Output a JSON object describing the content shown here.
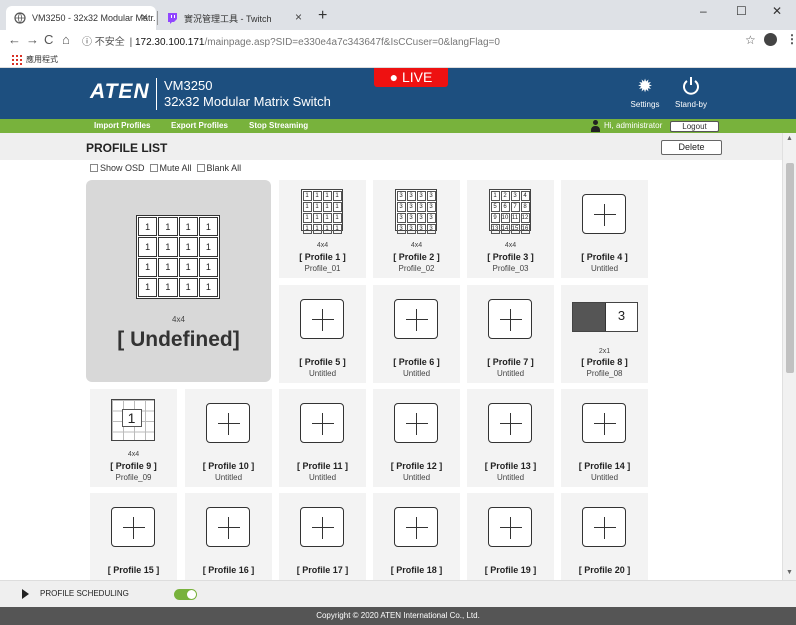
{
  "browser": {
    "tabs": [
      {
        "title": "VM3250 - 32x32 Modular Matr...",
        "active": true
      },
      {
        "title": "實況管理工具 - Twitch",
        "active": false
      }
    ],
    "new_tab": "+",
    "window_controls": [
      "–",
      "☐",
      "✕"
    ],
    "address": {
      "insecure_label": "不安全",
      "separator": "|",
      "host": "172.30.100.171",
      "path": "/mainpage.asp?SID=e330e4a7c343647f&IsCCuser=0&langFlag=0"
    },
    "bookmarks_label": "應用程式"
  },
  "header": {
    "logo": "ATEN",
    "model": "VM3250",
    "model_desc": "32x32 Modular Matrix Switch",
    "live": "● LIVE",
    "settings_label": "Settings",
    "standby_label": "Stand-by"
  },
  "menu": {
    "items": [
      "Import Profiles",
      "Export Profiles",
      "Stop Streaming"
    ],
    "greeting": "Hi, administrator",
    "logout": "Logout"
  },
  "profile_list": {
    "title": "PROFILE LIST",
    "delete": "Delete",
    "options": [
      "Show OSD",
      "Mute All",
      "Blank All"
    ],
    "current": {
      "layout": "4x4",
      "name": "[ Undefined]",
      "grid": [
        "1",
        "1",
        "1",
        "1",
        "1",
        "1",
        "1",
        "1",
        "1",
        "1",
        "1",
        "1",
        "1",
        "1",
        "1",
        "1"
      ]
    },
    "profiles": [
      {
        "name": "[ Profile 1 ]",
        "desc": "Profile_01",
        "layout": "4x4",
        "grid": [
          "1",
          "1",
          "1",
          "1",
          "1",
          "1",
          "1",
          "1",
          "1",
          "1",
          "1",
          "1",
          "1",
          "1",
          "1",
          "1"
        ]
      },
      {
        "name": "[ Profile 2 ]",
        "desc": "Profile_02",
        "layout": "4x4",
        "grid": [
          "3",
          "3",
          "3",
          "3",
          "3",
          "3",
          "3",
          "3",
          "3",
          "3",
          "3",
          "3",
          "3",
          "3",
          "3",
          "3"
        ]
      },
      {
        "name": "[ Profile 3 ]",
        "desc": "Profile_03",
        "layout": "4x4",
        "grid": [
          "1",
          "2",
          "3",
          "4",
          "5",
          "6",
          "7",
          "8",
          "9",
          "10",
          "11",
          "12",
          "13",
          "14",
          "15",
          "16"
        ]
      },
      {
        "name": "[ Profile 4 ]",
        "desc": "Untitled",
        "layout": "",
        "grid": []
      },
      {
        "name": "[ Profile 5 ]",
        "desc": "Untitled",
        "layout": "",
        "grid": []
      },
      {
        "name": "[ Profile 6 ]",
        "desc": "Untitled",
        "layout": "",
        "grid": []
      },
      {
        "name": "[ Profile 7 ]",
        "desc": "Untitled",
        "layout": "",
        "grid": []
      },
      {
        "name": "[ Profile 8 ]",
        "desc": "Profile_08",
        "layout": "2x1",
        "grid": [
          "",
          "3"
        ]
      },
      {
        "name": "[ Profile 9 ]",
        "desc": "Profile_09",
        "layout": "4x4",
        "grid": [
          "1"
        ]
      },
      {
        "name": "[ Profile 10 ]",
        "desc": "Untitled",
        "layout": "",
        "grid": []
      },
      {
        "name": "[ Profile 11 ]",
        "desc": "Untitled",
        "layout": "",
        "grid": []
      },
      {
        "name": "[ Profile 12 ]",
        "desc": "Untitled",
        "layout": "",
        "grid": []
      },
      {
        "name": "[ Profile 13 ]",
        "desc": "Untitled",
        "layout": "",
        "grid": []
      },
      {
        "name": "[ Profile 14 ]",
        "desc": "Untitled",
        "layout": "",
        "grid": []
      },
      {
        "name": "[ Profile 15 ]",
        "desc": "",
        "layout": "",
        "grid": []
      },
      {
        "name": "[ Profile 16 ]",
        "desc": "",
        "layout": "",
        "grid": []
      },
      {
        "name": "[ Profile 17 ]",
        "desc": "",
        "layout": "",
        "grid": []
      },
      {
        "name": "[ Profile 18 ]",
        "desc": "",
        "layout": "",
        "grid": []
      },
      {
        "name": "[ Profile 19 ]",
        "desc": "",
        "layout": "",
        "grid": []
      },
      {
        "name": "[ Profile 20 ]",
        "desc": "",
        "layout": "",
        "grid": []
      }
    ]
  },
  "scheduling": {
    "label": "PROFILE SCHEDULING",
    "enabled": true
  },
  "footer": {
    "copyright": "Copyright © 2020 ATEN International Co., Ltd."
  },
  "colors": {
    "header_bg": "#1d4f7f",
    "menu_bg": "#78b23c",
    "live_red": "#ee1111"
  }
}
